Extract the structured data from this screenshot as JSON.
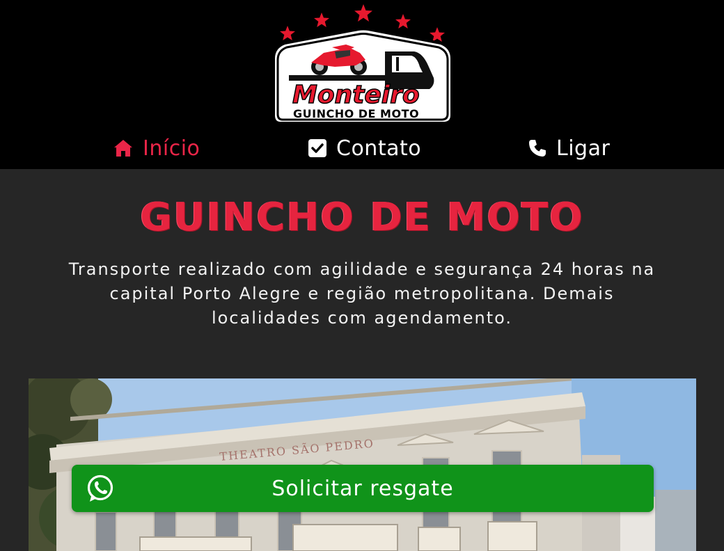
{
  "logo": {
    "brand": "Monteiro",
    "tagline": "GUINCHO DE MOTO"
  },
  "nav": {
    "items": [
      {
        "label": "Início",
        "icon": "home-icon",
        "active": true
      },
      {
        "label": "Contato",
        "icon": "check-square-icon",
        "active": false
      },
      {
        "label": "Ligar",
        "icon": "phone-icon",
        "active": false
      }
    ]
  },
  "hero": {
    "title": "GUINCHO DE MOTO",
    "description": "Transporte realizado com agilidade e segurança 24 horas na capital Porto Alegre e região metropolitana. Demais localidades com agendamento."
  },
  "photo": {
    "building_sign": "THEATRO SÃO PEDRO"
  },
  "cta": {
    "label": "Solicitar resgate",
    "icon": "whatsapp-icon"
  },
  "colors": {
    "accent": "#ea2548",
    "header_bg": "#000000",
    "page_bg": "#262626",
    "cta_bg": "#10931a"
  }
}
